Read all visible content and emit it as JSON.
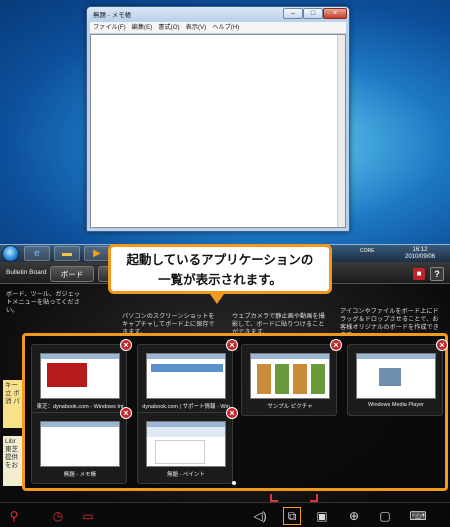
{
  "notepad": {
    "title": "無題 - メモ帳",
    "menus": [
      "ファイル(F)",
      "編集(E)",
      "書式(O)",
      "表示(V)",
      "ヘルプ(H)"
    ]
  },
  "taskbar": {
    "lang": "CORE",
    "time": "16:12",
    "date": "2010/09/06"
  },
  "board": {
    "title": "Bulletin Board",
    "tab_label": "ボード",
    "help_label": "?",
    "notes": [
      "ボード、ツール、ガジェットメニューを貼ってください。",
      "パソコンのスクリーンショットをキャプチャしてボード上に保存できます。",
      "ウェブカメラで静止画や動画を撮影して、ボードに貼りつけることができます。",
      "アイコンやファイルをボード上にドラッグ＆ドロップさせることで、お客様オリジナルのボードを作成できます。"
    ],
    "sticky1": "キー 立 ボ 消 パ",
    "sticky2": "Libr 東芝 提供 をお"
  },
  "callout": {
    "line1": "起動しているアプリケーションの",
    "line2": "一覧が表示されます。"
  },
  "switcher": {
    "apps": [
      {
        "caption": "東芝：dynabook.com - Windows Int",
        "shot": "dynabook"
      },
      {
        "caption": "dynabook.com | サポート情報 - Win",
        "shot": "support"
      },
      {
        "caption": "サンプル ピクチャ",
        "shot": "pictures"
      },
      {
        "caption": "Windows Media Player",
        "shot": "wmp"
      },
      {
        "caption": "無題 - メモ帳",
        "shot": "notepad"
      },
      {
        "caption": "無題 - ペイント",
        "shot": "paint"
      }
    ],
    "close_label": "×"
  },
  "bottom_bar": {
    "icons": [
      "pin-icon",
      "clock-icon",
      "folder-icon",
      "volume-icon",
      "app-switcher-icon",
      "window-icon",
      "zoom-icon",
      "display-icon",
      "keyboard-icon"
    ]
  },
  "colors": {
    "accent_orange": "#f39a1e",
    "close_red": "#c2272d",
    "toolbar_red": "#e0343a"
  }
}
